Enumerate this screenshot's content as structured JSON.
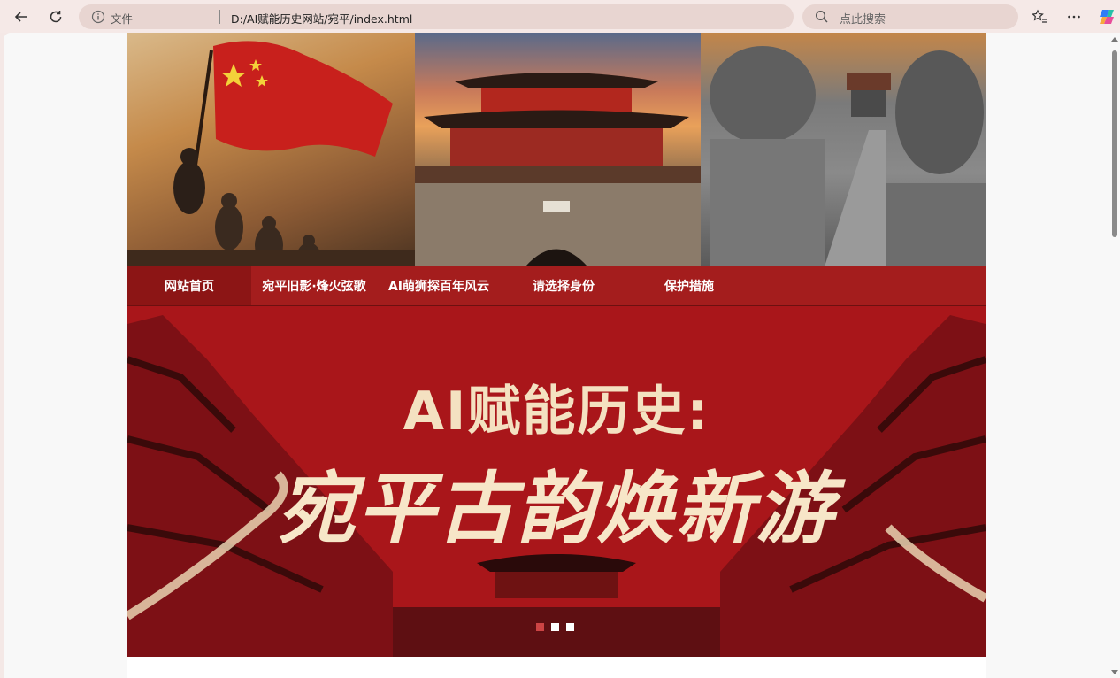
{
  "browser": {
    "file_label": "文件",
    "url": "D:/AI赋能历史网站/宛平/index.html",
    "search_placeholder": "点此搜索"
  },
  "nav": {
    "items": [
      {
        "label": "网站首页"
      },
      {
        "label": "宛平旧影·烽火弦歌"
      },
      {
        "label": "AI萌狮探百年风云"
      },
      {
        "label": "请选择身份"
      },
      {
        "label": "保护措施"
      }
    ]
  },
  "hero": {
    "title": "AI赋能历史:",
    "subtitle": "宛平古韵焕新游"
  },
  "carousel": {
    "count": 3,
    "active": 1
  },
  "colors": {
    "nav_bg": "#a41d1d",
    "hero_bg": "#a9161a",
    "hero_text": "#f4e1c1"
  }
}
